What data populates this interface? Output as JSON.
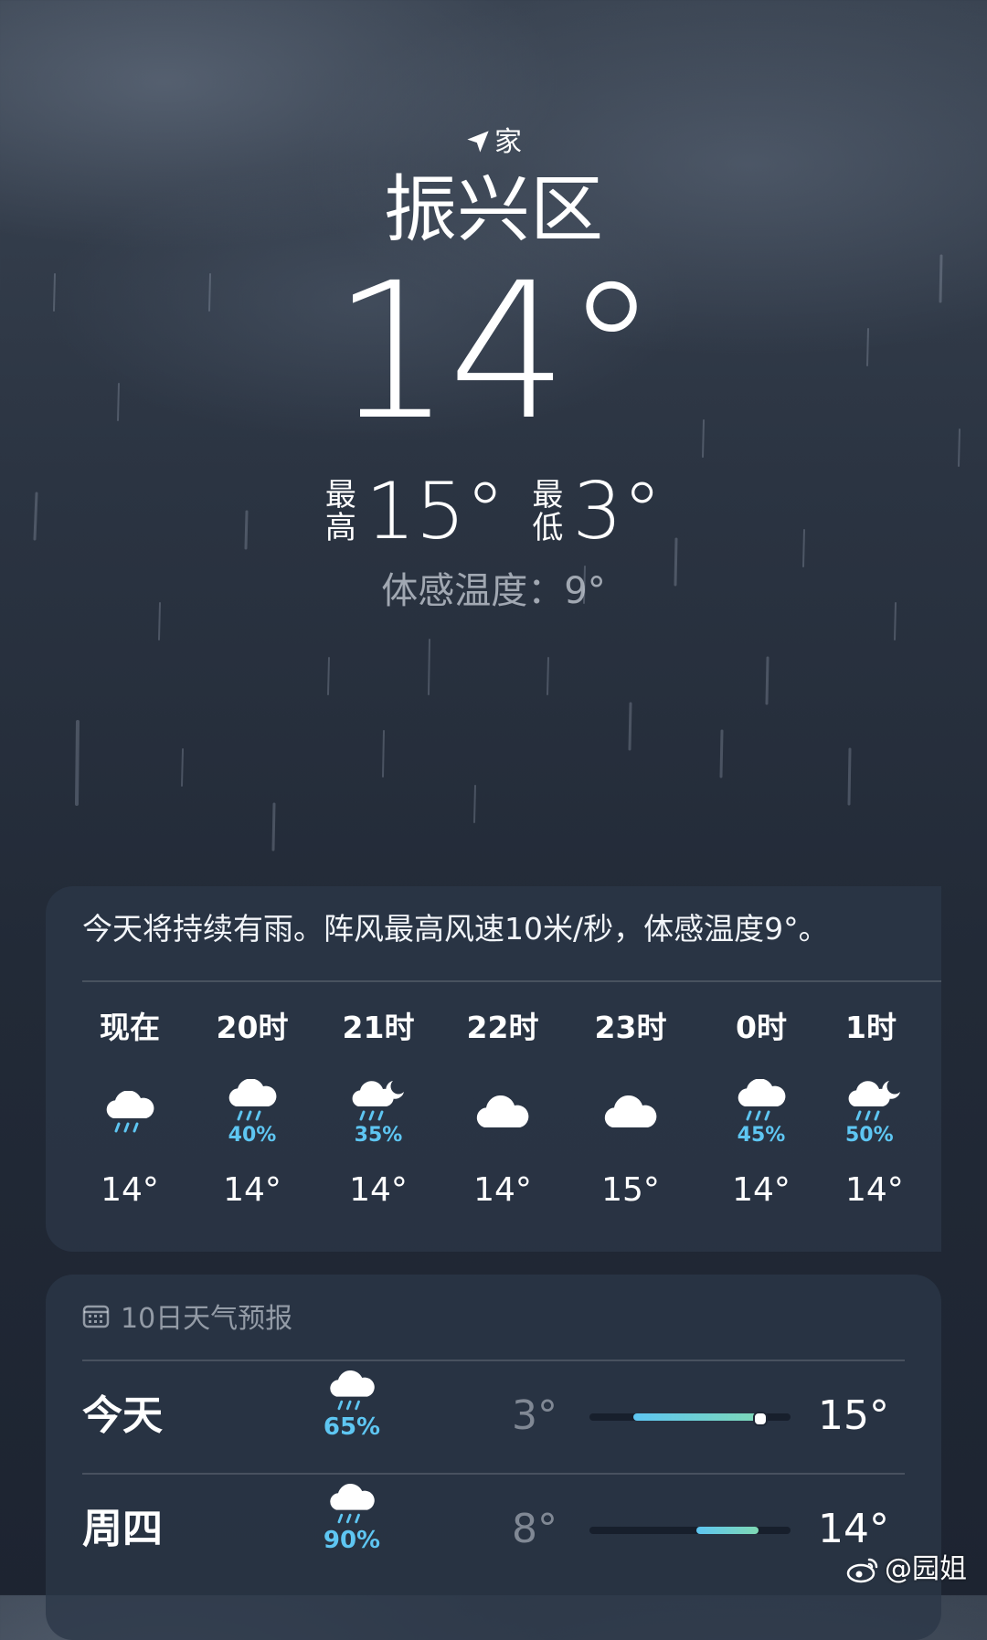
{
  "location": {
    "tag": "家",
    "city": "振兴区"
  },
  "current": {
    "temp": "14°",
    "high_label_1": "最",
    "high_label_2": "高",
    "high": "15°",
    "low_label_1": "最",
    "low_label_2": "低",
    "low": "3°",
    "feels_like": "体感温度：9°"
  },
  "hourly": {
    "summary": "今天将持续有雨。阵风最高风速10米/秒，体感温度9°。",
    "items": [
      {
        "time": "现在",
        "icon": "cloud-rain-icon",
        "precip": "",
        "temp": "14°"
      },
      {
        "time": "20时",
        "icon": "cloud-rain-icon",
        "precip": "40%",
        "temp": "14°"
      },
      {
        "time": "21时",
        "icon": "cloud-moon-rain-icon",
        "precip": "35%",
        "temp": "14°"
      },
      {
        "time": "22时",
        "icon": "cloud-icon",
        "precip": "",
        "temp": "14°"
      },
      {
        "time": "23时",
        "icon": "cloud-icon",
        "precip": "",
        "temp": "15°"
      },
      {
        "time": "0时",
        "icon": "cloud-rain-icon",
        "precip": "45%",
        "temp": "14°"
      },
      {
        "time": "1时",
        "icon": "cloud-moon-rain-icon",
        "precip": "50%",
        "temp": "14°"
      }
    ]
  },
  "daily": {
    "title": "10日天气预报",
    "days": [
      {
        "day": "今天",
        "icon": "cloud-rain-icon",
        "precip": "65%",
        "low": "3°",
        "high": "15°",
        "range_start": 0.22,
        "range_end": 0.88,
        "current_position": 0.84
      },
      {
        "day": "周四",
        "icon": "cloud-rain-icon",
        "precip": "90%",
        "low": "8°",
        "high": "14°",
        "range_start": 0.53,
        "range_end": 0.84
      }
    ]
  },
  "watermark": "@园姐",
  "colors": {
    "precip": "#5ec6f2",
    "bar_start": "#5ec6f2",
    "bar_end": "#7fd9b4"
  }
}
